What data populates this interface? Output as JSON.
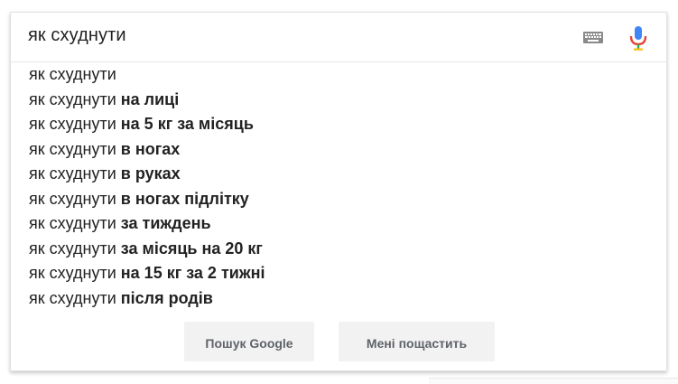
{
  "search": {
    "query": "як схуднути"
  },
  "icons": {
    "keyboard": "keyboard-icon",
    "microphone": "microphone-icon"
  },
  "suggestions": [
    {
      "prefix": "як схуднути",
      "suffix": ""
    },
    {
      "prefix": "як схуднути",
      "suffix": "на лиці"
    },
    {
      "prefix": "як схуднути",
      "suffix": "на 5 кг за місяць"
    },
    {
      "prefix": "як схуднути",
      "suffix": "в ногах"
    },
    {
      "prefix": "як схуднути",
      "suffix": "в руках"
    },
    {
      "prefix": "як схуднути",
      "suffix": "в ногах підлітку"
    },
    {
      "prefix": "як схуднути",
      "suffix": "за тиждень"
    },
    {
      "prefix": "як схуднути",
      "suffix": "за місяць на 20 кг"
    },
    {
      "prefix": "як схуднути",
      "suffix": "на 15 кг за 2 тижні"
    },
    {
      "prefix": "як схуднути",
      "suffix": "після родів"
    }
  ],
  "buttons": {
    "search_label": "Пошук Google",
    "lucky_label": "Мені пощастить"
  },
  "colors": {
    "mic_blue": "#4285f4",
    "mic_red": "#ea4335",
    "mic_yellow": "#fbbc05",
    "mic_green": "#34a853",
    "keyboard_gray": "#757575"
  }
}
